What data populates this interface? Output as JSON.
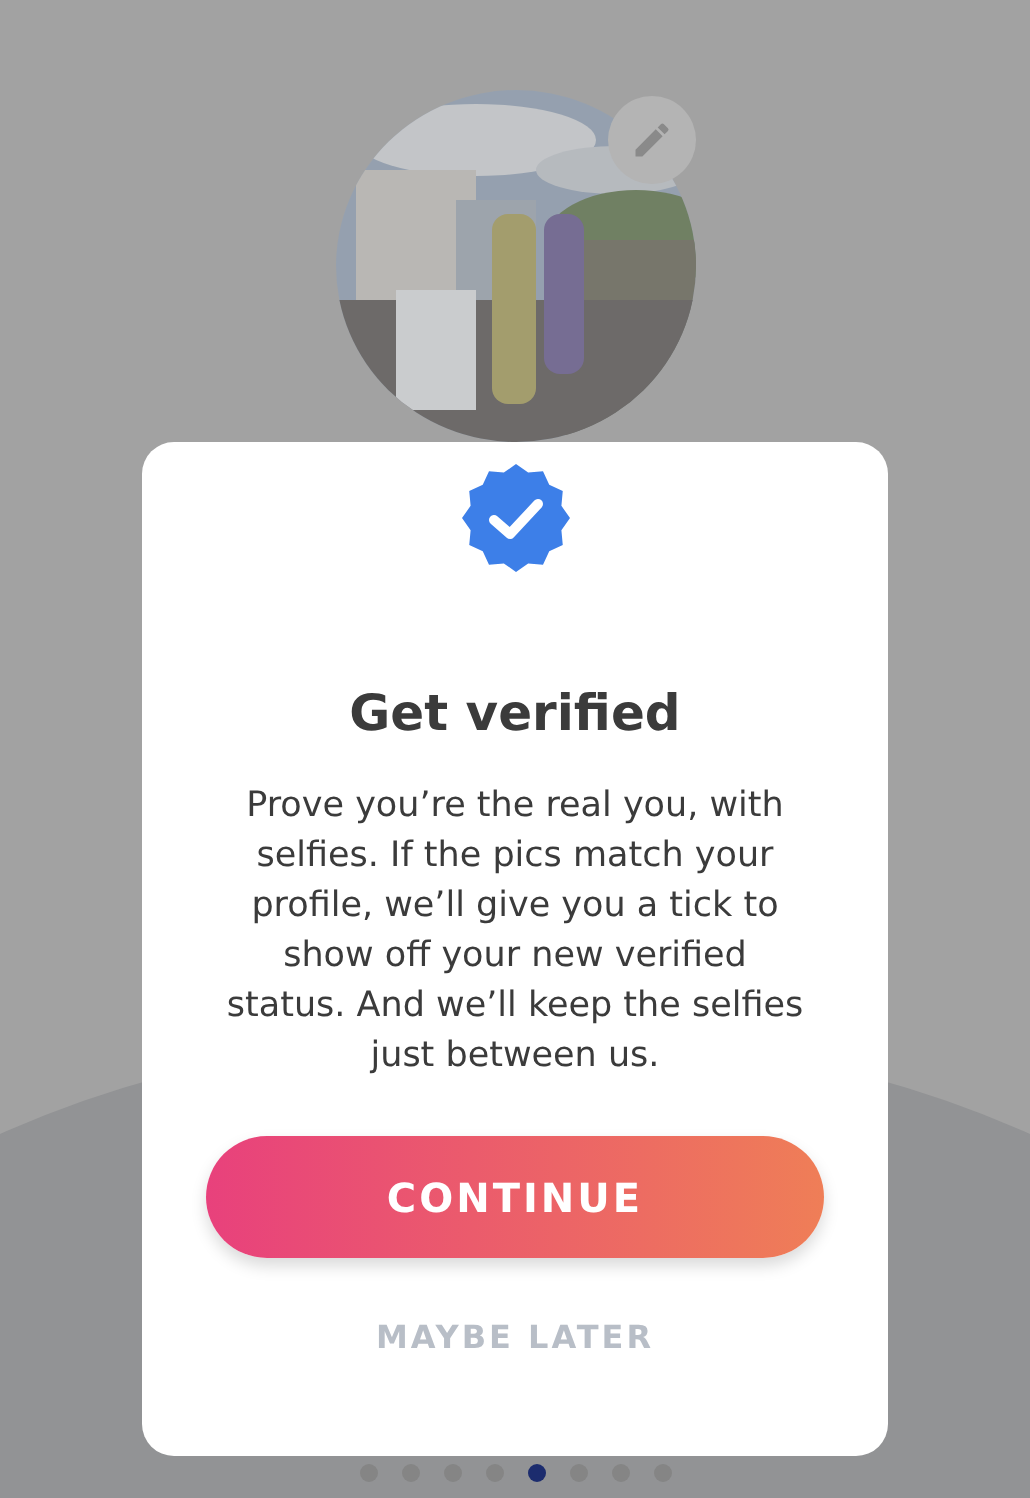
{
  "dialog": {
    "title": "Get verified",
    "body": "Prove you’re the real you, with selfies. If the pics match your profile, we’ll give you a tick to show off your new verified status. And we’ll keep the selfies just between us.",
    "primary_button": "CONTINUE",
    "secondary_button": "MAYBE LATER"
  },
  "page_dots": [
    {
      "selected": false
    },
    {
      "selected": false
    },
    {
      "selected": false
    },
    {
      "selected": false
    },
    {
      "selected": true
    },
    {
      "selected": false
    },
    {
      "selected": false
    },
    {
      "selected": false
    }
  ]
}
